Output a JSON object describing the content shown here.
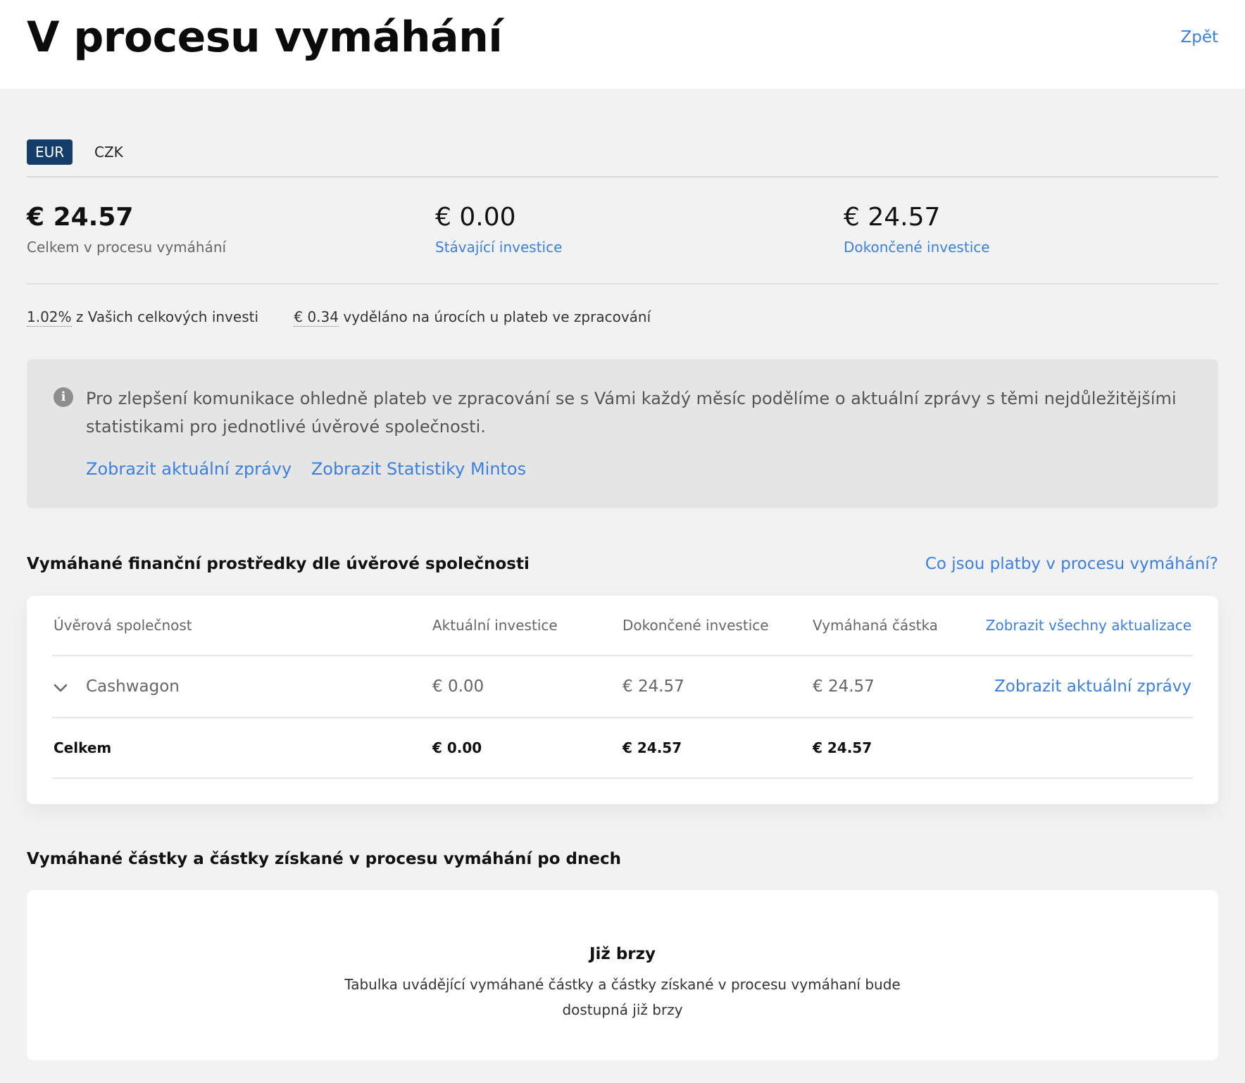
{
  "header": {
    "title": "V procesu vymáhání",
    "back_label": "Zpět"
  },
  "currency_tabs": {
    "active": "EUR",
    "inactive": "CZK"
  },
  "stats": {
    "total_value": "€ 24.57",
    "total_label": "Celkem v procesu vymáhání",
    "current_value": "€ 0.00",
    "current_label": "Stávající investice",
    "finished_value": "€ 24.57",
    "finished_label": "Dokončené investice"
  },
  "summary": {
    "percent": "1.02%",
    "percent_text": " z Vašich celkových investi",
    "interest": "€ 0.34",
    "interest_text": " vyděláno na úrocích u plateb ve zpracování"
  },
  "info_box": {
    "text": "Pro zlepšení komunikace ohledně plateb ve zpracování se s Vámi každý měsíc podělíme o aktuální zprávy s těmi nejdůležitějšími statistikami pro jednotlivé úvěrové společnosti.",
    "link1": "Zobrazit aktuální zprávy",
    "link2": "Zobrazit Statistiky Mintos"
  },
  "section1": {
    "title": "Vymáhané finanční prostředky dle úvěrové společnosti",
    "help_link": "Co jsou platby v procesu vymáhání?"
  },
  "table": {
    "headers": {
      "company": "Úvěrová společnost",
      "current": "Aktuální investice",
      "finished": "Dokončené investice",
      "amount": "Vymáhaná částka",
      "all_updates": "Zobrazit všechny aktualizace"
    },
    "rows": [
      {
        "company": "Cashwagon",
        "current": "€ 0.00",
        "finished": "€ 24.57",
        "amount": "€ 24.57",
        "action": "Zobrazit aktuální zprávy"
      }
    ],
    "total": {
      "label": "Celkem",
      "current": "€ 0.00",
      "finished": "€ 24.57",
      "amount": "€ 24.57"
    }
  },
  "section2": {
    "title": "Vymáhané částky a částky získané v procesu vymáhání po dnech",
    "soon_title": "Již brzy",
    "soon_text": "Tabulka uvádějící vymáhané částky a částky získané v procesu vymáhaní bude dostupná již brzy"
  },
  "colors": {
    "accent_link": "#3b7fe0",
    "tab_active": "#143d6b"
  },
  "icons": {
    "info": "info-icon",
    "expand": "chevron-down-icon"
  }
}
